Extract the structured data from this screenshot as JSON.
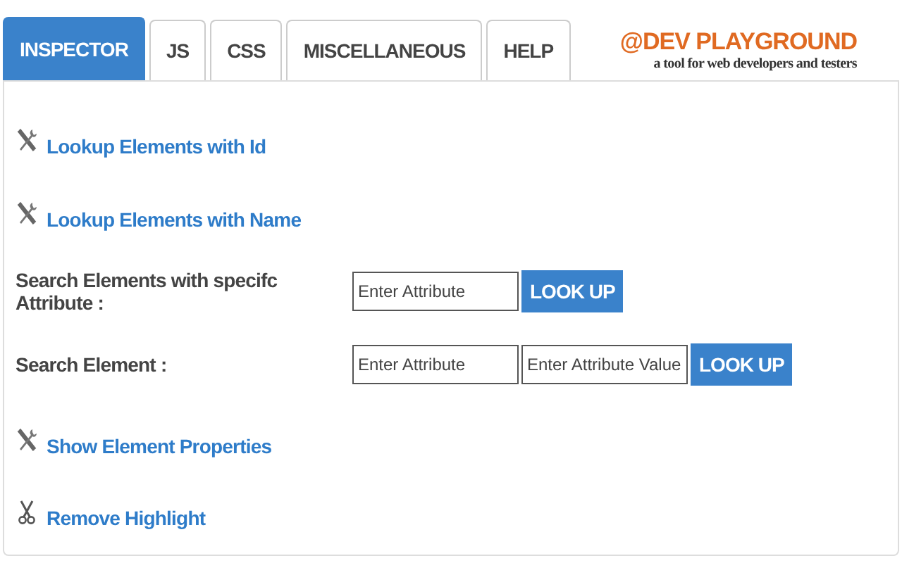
{
  "tabs": [
    {
      "label": "INSPECTOR",
      "selected": true
    },
    {
      "label": "JS",
      "selected": false
    },
    {
      "label": "CSS",
      "selected": false
    },
    {
      "label": "MISCELLANEOUS",
      "selected": false
    },
    {
      "label": "HELP",
      "selected": false
    }
  ],
  "logo": {
    "title": "@DEV PLAYGROUND",
    "tagline": "a tool for web developers and testers"
  },
  "rows": [
    {
      "kind": "tool-link",
      "label": "Lookup Elements with Id"
    },
    {
      "kind": "tool-link",
      "label": "Lookup Elements with Name"
    },
    {
      "kind": "search",
      "label": "Search Elements with specifc Attribute :",
      "fields": [
        {
          "placeholder": "Enter Attribute"
        }
      ],
      "button": "LOOK UP"
    },
    {
      "kind": "search",
      "label": "Search Element :",
      "fields": [
        {
          "placeholder": "Enter Attribute"
        },
        {
          "placeholder": "Enter Attribute Value"
        }
      ],
      "button": "LOOK UP"
    },
    {
      "kind": "tool-link",
      "label": "Show Element Properties"
    },
    {
      "kind": "clear-link",
      "label": "Remove Highlight"
    }
  ]
}
